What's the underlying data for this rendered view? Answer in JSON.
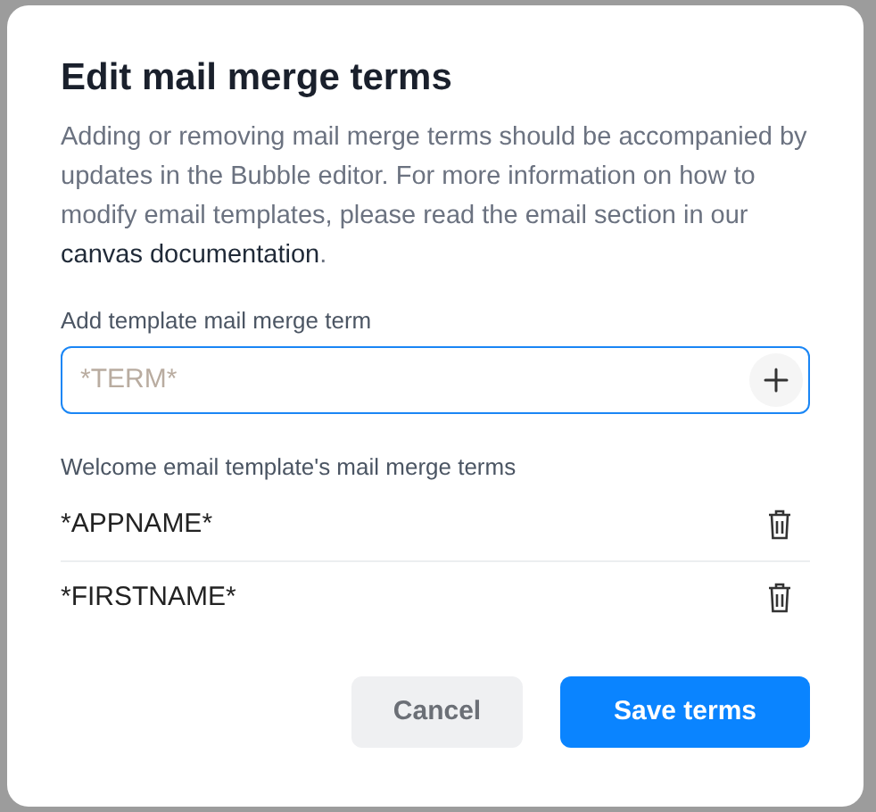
{
  "dialog": {
    "title": "Edit mail merge terms",
    "description": "Adding or removing mail merge terms should be accompanied by updates in the Bubble editor. For more information on how to modify email templates, please read the email section in our ",
    "description_link": "canvas documentation",
    "description_end": ".",
    "add_label": "Add template mail merge term",
    "add_field": {
      "placeholder": "*TERM*",
      "focused": true
    },
    "list_label": "Welcome email template's mail merge terms",
    "terms": [
      {
        "name": "*APPNAME*"
      },
      {
        "name": "*FIRSTNAME*"
      }
    ],
    "buttons": [
      {
        "label": "Cancel",
        "kind": "secondary"
      },
      {
        "label": "Save terms",
        "kind": "primary"
      }
    ]
  }
}
